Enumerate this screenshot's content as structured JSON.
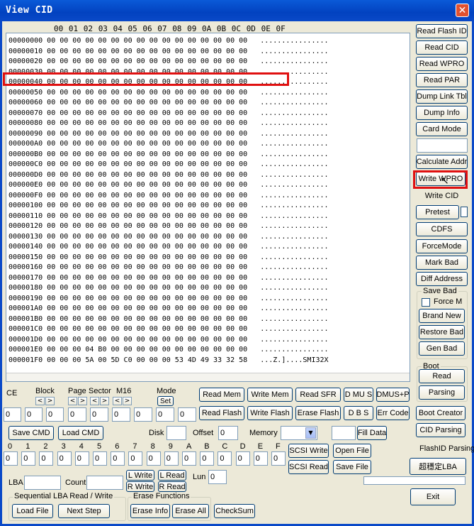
{
  "window": {
    "title": "View CID",
    "close_glyph": "✕"
  },
  "hex": {
    "columns": [
      "00",
      "01",
      "02",
      "03",
      "04",
      "05",
      "06",
      "07",
      "08",
      "09",
      "0A",
      "0B",
      "0C",
      "0D",
      "0E",
      "0F"
    ],
    "rows": [
      "00000000 00 00 00 00 00 00 00 00 00 00 00 00 00 00 00 00   ................",
      "00000010 00 00 00 00 00 00 00 00 00 00 00 00 00 00 00 00   ................",
      "00000020 00 00 00 00 00 00 00 00 00 00 00 00 00 00 00 00   ................",
      "00000030 00 00 00 00 00 00 00 00 00 00 00 00 00 00 00 00   ................",
      "00000040 00 00 00 00 00 00 00 00 00 00 00 00 00 00 00 00   ................",
      "00000050 00 00 00 00 00 00 00 00 00 00 00 00 00 00 00 00   ................",
      "00000060 00 00 00 00 00 00 00 00 00 00 00 00 00 00 00 00   ................",
      "00000070 00 00 00 00 00 00 00 00 00 00 00 00 00 00 00 00   ................",
      "00000080 00 00 00 00 00 00 00 00 00 00 00 00 00 00 00 00   ................",
      "00000090 00 00 00 00 00 00 00 00 00 00 00 00 00 00 00 00   ................",
      "000000A0 00 00 00 00 00 00 00 00 00 00 00 00 00 00 00 00   ................",
      "000000B0 00 00 00 00 00 00 00 00 00 00 00 00 00 00 00 00   ................",
      "000000C0 00 00 00 00 00 00 00 00 00 00 00 00 00 00 00 00   ................",
      "000000D0 00 00 00 00 00 00 00 00 00 00 00 00 00 00 00 00   ................",
      "000000E0 00 00 00 00 00 00 00 00 00 00 00 00 00 00 00 00   ................",
      "000000F0 00 00 00 00 00 00 00 00 00 00 00 00 00 00 00 00   ................",
      "00000100 00 00 00 00 00 00 00 00 00 00 00 00 00 00 00 00   ................",
      "00000110 00 00 00 00 00 00 00 00 00 00 00 00 00 00 00 00   ................",
      "00000120 00 00 00 00 00 00 00 00 00 00 00 00 00 00 00 00   ................",
      "00000130 00 00 00 00 00 00 00 00 00 00 00 00 00 00 00 00   ................",
      "00000140 00 00 00 00 00 00 00 00 00 00 00 00 00 00 00 00   ................",
      "00000150 00 00 00 00 00 00 00 00 00 00 00 00 00 00 00 00   ................",
      "00000160 00 00 00 00 00 00 00 00 00 00 00 00 00 00 00 00   ................",
      "00000170 00 00 00 00 00 00 00 00 00 00 00 00 00 00 00 00   ................",
      "00000180 00 00 00 00 00 00 00 00 00 00 00 00 00 00 00 00   ................",
      "00000190 00 00 00 00 00 00 00 00 00 00 00 00 00 00 00 00   ................",
      "000001A0 00 00 00 00 00 00 00 00 00 00 00 00 00 00 00 00   ................",
      "000001B0 00 00 00 00 00 00 00 00 00 00 00 00 00 00 00 00   ................",
      "000001C0 00 00 00 00 00 00 00 00 00 00 00 00 00 00 00 00   ................",
      "000001D0 00 00 00 00 00 00 00 00 00 00 00 00 00 00 00 00   ................",
      "000001E0 00 00 00 04 B0 00 00 00 00 00 00 00 00 00 00 00   ................",
      "000001F0 00 00 00 5A 00 5D C0 00 00 00 53 4D 49 33 32 58   ...Z.]....SMI32X"
    ]
  },
  "side_buttons": [
    "Read Flash ID",
    "Read CID",
    "Read WPRO",
    "Read PAR",
    "Dump Link Tbl",
    "Dump Info",
    "Card Mode",
    "Calculate Addr",
    "Write WPRO",
    "Write CID",
    "Pretest",
    "CDFS",
    "ForceMode",
    "Mark Bad",
    "Diff Address"
  ],
  "save_bad": {
    "group_label": "Save Bad",
    "force_label": "Force M",
    "brand_new": "Brand New",
    "restore_bad": "Restore Bad",
    "gen_bad": "Gen Bad"
  },
  "boot": {
    "group_label": "Boot",
    "read": "Read",
    "parsing": "Parsing"
  },
  "right_lower": {
    "boot_creator": "Boot Creator",
    "cid_parsing": "CID Parsing",
    "flashid_parsing": "FlashID Parsing",
    "lba_button": "超穩定LBA",
    "exit": "Exit"
  },
  "params": {
    "ce": "CE",
    "block": "Block",
    "page": "Page",
    "sector": "Sector",
    "m16": "M16",
    "mode": "Mode",
    "set": "Set",
    "left_arrow": "<",
    "right_arrow": ">",
    "values": [
      "0",
      "0",
      "0",
      "0",
      "0",
      "0",
      "0",
      "0",
      "0"
    ]
  },
  "mid_buttons": {
    "read_mem": "Read Mem",
    "write_mem": "Write Mem",
    "read_sfr": "Read SFR",
    "dmus": "D MU S",
    "dmusp": "DMUS+P",
    "read_flash": "Read Flash",
    "write_flash": "Write Flash",
    "erase_flash": "Erase Flash",
    "dbs": "D B S",
    "err_code": "Err Code"
  },
  "cmd_row": {
    "save_cmd": "Save CMD",
    "load_cmd": "Load CMD",
    "disk": "Disk",
    "offset": "Offset",
    "offset_value": "0",
    "memory": "Memory",
    "fill_data": "Fill Data"
  },
  "bytes": {
    "labels": [
      "0",
      "1",
      "2",
      "3",
      "4",
      "5",
      "6",
      "7",
      "8",
      "9",
      "A",
      "B",
      "C",
      "D",
      "E",
      "F"
    ],
    "values": [
      "0",
      "0",
      "0",
      "0",
      "0",
      "0",
      "0",
      "0",
      "0",
      "0",
      "0",
      "0",
      "0",
      "0",
      "0",
      "0"
    ]
  },
  "scsi": {
    "write": "SCSI Write",
    "read": "SCSI Read",
    "open_file": "Open File",
    "save_file": "Save File"
  },
  "lba": {
    "lba": "LBA",
    "count": "Count",
    "l_write": "L Write",
    "l_read": "L Read",
    "r_write": "R Write",
    "r_read": "R Read",
    "lun": "Lun",
    "lun_value": "0"
  },
  "seq": {
    "group_label": "Sequential LBA Read / Write",
    "load_file": "Load File",
    "next_step": "Next Step"
  },
  "erase": {
    "group_label": "Erase Functions",
    "erase_info": "Erase Info",
    "erase_all": "Erase All",
    "checksum": "CheckSum"
  }
}
